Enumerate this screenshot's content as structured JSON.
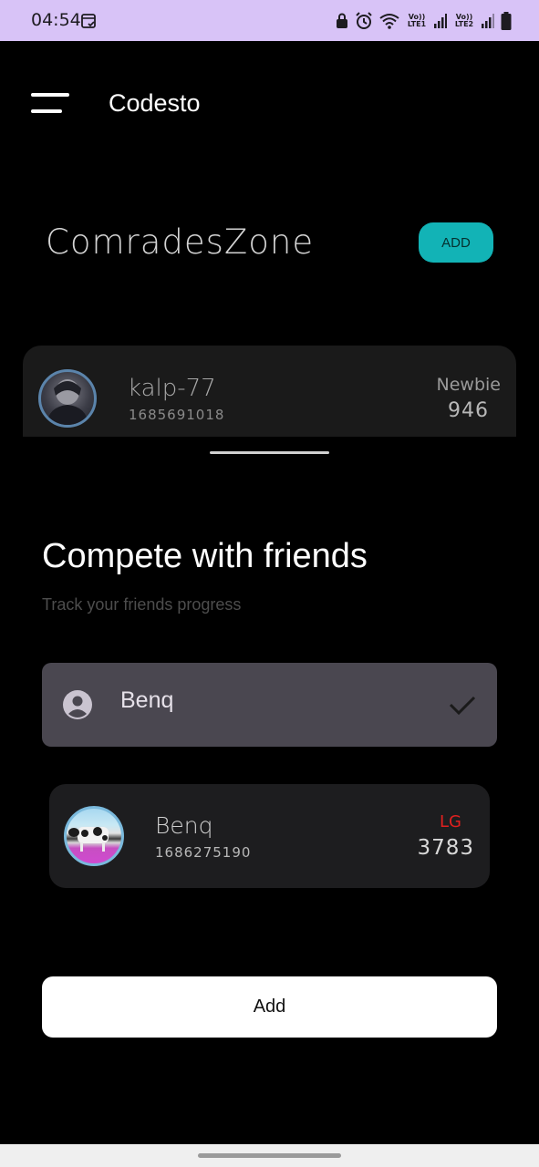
{
  "status_bar": {
    "time": "04:54",
    "network_labels": [
      "Vo)) LTE1",
      "Vo)) LTE2"
    ],
    "icons": [
      "calendar-check-icon",
      "lock-icon",
      "alarm-icon",
      "wifi-icon",
      "signal-icon",
      "battery-icon"
    ]
  },
  "app_bar": {
    "title": "Codesto",
    "menu_icon": "hamburger-menu-icon"
  },
  "zone": {
    "title": "ComradesZone",
    "add_label": "ADD",
    "accent_color": "#12b3b6"
  },
  "profile": {
    "handle": "kalp-77",
    "id": "1685691018",
    "rank": "Newbie",
    "rating": "946"
  },
  "sheet": {
    "title": "Compete with friends",
    "subtitle": "Track your friends progress",
    "search_field": {
      "value": "Benq",
      "leading_icon": "person-circle-icon",
      "trailing_icon": "check-icon"
    },
    "result": {
      "handle": "Benq",
      "id": "1686275190",
      "rank": "LG",
      "rank_color": "#e0201f",
      "rating": "3783"
    },
    "add_button_label": "Add"
  }
}
